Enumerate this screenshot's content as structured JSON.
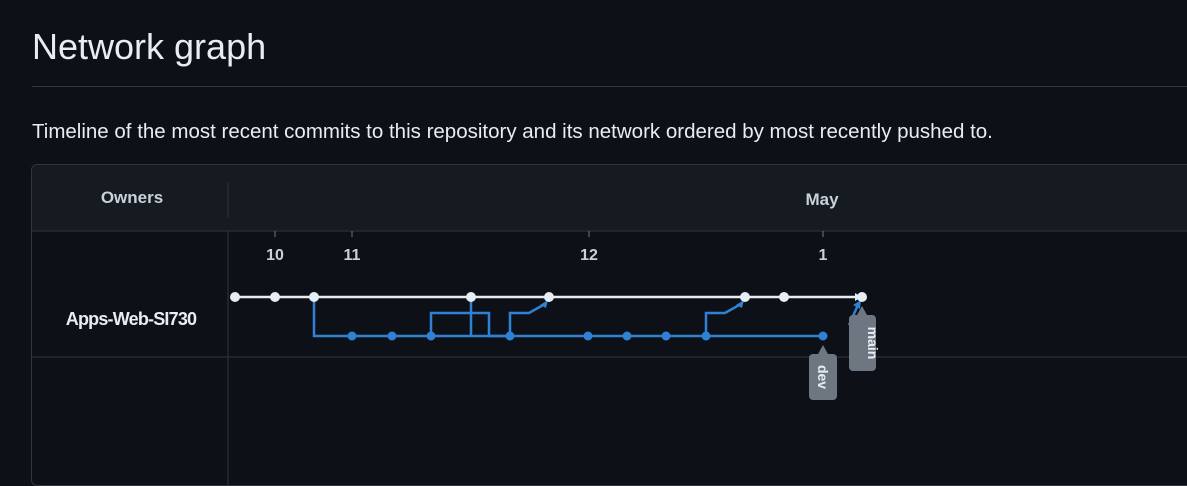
{
  "page": {
    "title": "Network graph",
    "description": "Timeline of the most recent commits to this repository and its network ordered by most recently pushed to."
  },
  "graph": {
    "owners_header": "Owners",
    "month_label": "May",
    "date_ticks": [
      "10",
      "11",
      "12",
      "1"
    ],
    "owner": "Apps-Web-SI730",
    "branch_labels": {
      "main": "main",
      "dev": "dev"
    },
    "colors": {
      "main_branch": "#e6edf3",
      "dev_branch": "#2f81d4",
      "header_bg": "#161b22",
      "border": "#30363d",
      "label_bg": "#6e7681"
    }
  }
}
